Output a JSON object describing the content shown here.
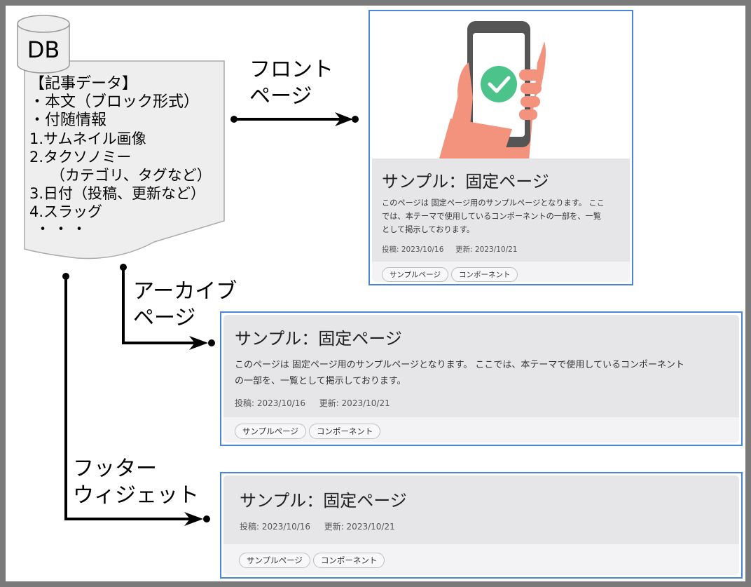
{
  "db": {
    "label": "DB"
  },
  "article": {
    "lines": [
      "【記事データ】",
      "・本文（ブロック形式）",
      "・付随情報",
      "1.サムネイル画像",
      "2.タクソノミー",
      "（カテゴリ、タグなど）",
      "3.日付（投稿、更新など）",
      "4.スラッグ",
      "・・・"
    ]
  },
  "arrows": {
    "front": [
      "フロント",
      "ページ"
    ],
    "archive": [
      "アーカイブ",
      "ページ"
    ],
    "footer": [
      "フッター",
      "ウィジェット"
    ]
  },
  "card": {
    "title": "サンプル：固定ページ",
    "desc_front": [
      "このページは 固定ページ用のサンプルページとなります。 ここ",
      "では、本テーマで使用しているコンポーネントの一部を、一覧",
      "として掲示しております。"
    ],
    "desc_archive": [
      "このページは 固定ページ用のサンプルページとなります。 ここでは、本テーマで使用しているコンポーネント",
      "の一部を、一覧として掲示しております。"
    ],
    "posted": "投稿: 2023/10/16",
    "updated": "更新: 2023/10/21",
    "tags": [
      "サンプルページ",
      "コンポーネント"
    ]
  },
  "colors": {
    "card_border": "#4a86d8",
    "phone_body": "#555555",
    "check_circle": "#4cc38a",
    "hand": "#f3927d"
  },
  "icons": {
    "thumbnail": "hand-holding-phone-check-icon",
    "database": "database-cylinder-icon"
  }
}
